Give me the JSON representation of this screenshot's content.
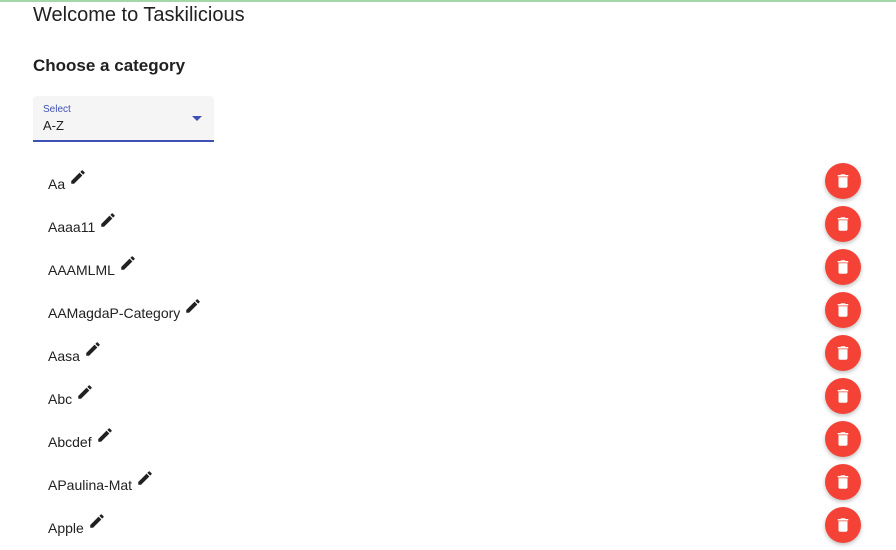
{
  "header": {
    "title": "Welcome to Taskilicious",
    "subtitle": "Choose a category"
  },
  "select": {
    "label": "Select",
    "value": "A-Z"
  },
  "categories": [
    {
      "name": "Aa"
    },
    {
      "name": "Aaaa11"
    },
    {
      "name": "AAAMLML"
    },
    {
      "name": "AAMagdaP-Category"
    },
    {
      "name": "Aasa"
    },
    {
      "name": "Abc"
    },
    {
      "name": "Abcdef"
    },
    {
      "name": "APaulina-Mat"
    },
    {
      "name": "Apple"
    }
  ],
  "icons": {
    "edit": "pencil-icon",
    "delete": "trash-icon",
    "dropdown": "chevron-down-icon"
  },
  "colors": {
    "accent": "#3f51b5",
    "delete": "#f44336",
    "top_border": "#a5d6a7"
  }
}
